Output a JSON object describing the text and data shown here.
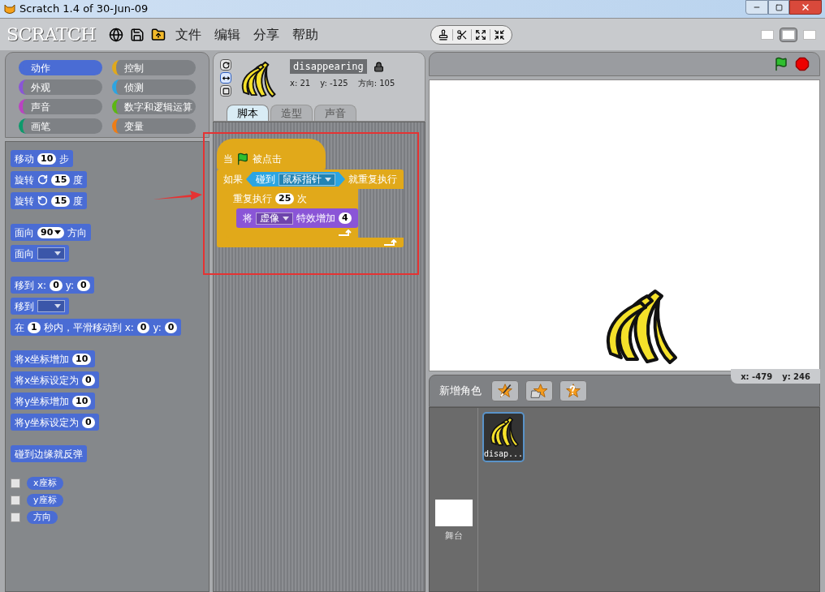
{
  "window": {
    "title": "Scratch 1.4 of 30-Jun-09"
  },
  "menu": {
    "logo": "SCRATCH",
    "items": [
      "文件",
      "编辑",
      "分享",
      "帮助"
    ]
  },
  "view_modes": [
    {
      "selected": false
    },
    {
      "selected": true
    },
    {
      "selected": false
    }
  ],
  "categories": [
    {
      "label": "动作",
      "color": "#4a6cd4",
      "selected": true
    },
    {
      "label": "控制",
      "color": "#e1a91a",
      "selected": false
    },
    {
      "label": "外观",
      "color": "#8a55d7",
      "selected": false
    },
    {
      "label": "侦测",
      "color": "#2ca5e2",
      "selected": false
    },
    {
      "label": "声音",
      "color": "#bb42c3",
      "selected": false
    },
    {
      "label": "数字和逻辑运算",
      "color": "#5cb712",
      "selected": false
    },
    {
      "label": "画笔",
      "color": "#0e9a6c",
      "selected": false
    },
    {
      "label": "变量",
      "color": "#ee7d16",
      "selected": false
    }
  ],
  "palette": {
    "groups": [
      [
        {
          "kind": "command",
          "parts": [
            {
              "kind": "text",
              "text": "移动"
            },
            {
              "kind": "number",
              "text": "10"
            },
            {
              "kind": "text",
              "text": "步"
            }
          ]
        },
        {
          "kind": "command",
          "parts": [
            {
              "kind": "text",
              "text": "旋转"
            },
            {
              "kind": "rotate_cw"
            },
            {
              "kind": "number",
              "text": "15"
            },
            {
              "kind": "text",
              "text": "度"
            }
          ]
        },
        {
          "kind": "command",
          "parts": [
            {
              "kind": "text",
              "text": "旋转"
            },
            {
              "kind": "rotate_ccw"
            },
            {
              "kind": "number",
              "text": "15"
            },
            {
              "kind": "text",
              "text": "度"
            }
          ]
        }
      ],
      [
        {
          "kind": "command",
          "parts": [
            {
              "kind": "text",
              "text": "面向"
            },
            {
              "kind": "number_dropdown",
              "text": "90"
            },
            {
              "kind": "text",
              "text": "方向"
            }
          ]
        },
        {
          "kind": "command",
          "parts": [
            {
              "kind": "text",
              "text": "面向"
            },
            {
              "kind": "dropdown"
            }
          ]
        }
      ],
      [
        {
          "kind": "command",
          "parts": [
            {
              "kind": "text",
              "text": "移到"
            },
            {
              "kind": "text",
              "text": "x:"
            },
            {
              "kind": "number",
              "text": "0"
            },
            {
              "kind": "text",
              "text": "y:"
            },
            {
              "kind": "number",
              "text": "0"
            }
          ]
        },
        {
          "kind": "command",
          "parts": [
            {
              "kind": "text",
              "text": "移到"
            },
            {
              "kind": "dropdown"
            }
          ]
        },
        {
          "kind": "command",
          "parts": [
            {
              "kind": "text",
              "text": "在"
            },
            {
              "kind": "number",
              "text": "1"
            },
            {
              "kind": "text",
              "text": "秒内，平滑移动到"
            },
            {
              "kind": "text",
              "text": "x:"
            },
            {
              "kind": "number",
              "text": "0"
            },
            {
              "kind": "text",
              "text": "y:"
            },
            {
              "kind": "number",
              "text": "0"
            }
          ]
        }
      ],
      [
        {
          "kind": "command",
          "parts": [
            {
              "kind": "text",
              "text": "将x坐标增加"
            },
            {
              "kind": "number",
              "text": "10"
            }
          ]
        },
        {
          "kind": "command",
          "parts": [
            {
              "kind": "text",
              "text": "将x坐标设定为"
            },
            {
              "kind": "number",
              "text": "0"
            }
          ]
        },
        {
          "kind": "command",
          "parts": [
            {
              "kind": "text",
              "text": "将y坐标增加"
            },
            {
              "kind": "number",
              "text": "10"
            }
          ]
        },
        {
          "kind": "command",
          "parts": [
            {
              "kind": "text",
              "text": "将y坐标设定为"
            },
            {
              "kind": "number",
              "text": "0"
            }
          ]
        }
      ],
      [
        {
          "kind": "command",
          "parts": [
            {
              "kind": "text",
              "text": "碰到边缘就反弹"
            }
          ]
        }
      ],
      [
        {
          "kind": "reporter",
          "checked": false,
          "parts": [
            {
              "kind": "text",
              "text": "x座标"
            }
          ]
        },
        {
          "kind": "reporter",
          "checked": false,
          "parts": [
            {
              "kind": "text",
              "text": "y座标"
            }
          ]
        },
        {
          "kind": "reporter",
          "checked": false,
          "parts": [
            {
              "kind": "text",
              "text": "方向"
            }
          ]
        }
      ]
    ]
  },
  "sprite": {
    "name": "disappearing",
    "x": "x: 21",
    "y": "y: -125",
    "direction": "方向: 105",
    "rotation_styles": [
      {
        "kind": "rotate",
        "selected": false
      },
      {
        "kind": "flip",
        "selected": true
      },
      {
        "kind": "none",
        "selected": false
      }
    ]
  },
  "tabs": [
    {
      "label": "脚本",
      "selected": true
    },
    {
      "label": "造型",
      "selected": false
    },
    {
      "label": "声音",
      "selected": false
    }
  ],
  "script": [
    {
      "kind": "hat",
      "color": "#e1a91a",
      "parts": [
        {
          "kind": "text",
          "text": "当"
        },
        {
          "kind": "flag"
        },
        {
          "kind": "text",
          "text": "被点击"
        }
      ]
    },
    {
      "kind": "c_block",
      "color": "#e1a91a",
      "parts": [
        {
          "kind": "text",
          "text": "如果"
        },
        {
          "kind": "boolean",
          "color": "#2ca5e2",
          "parts": [
            {
              "kind": "text",
              "text": "碰到"
            },
            {
              "kind": "dropdown",
              "text": "鼠标指针"
            }
          ]
        },
        {
          "kind": "text",
          "text": "就重复执行"
        }
      ],
      "children": [
        {
          "kind": "c_block",
          "color": "#e1a91a",
          "parts": [
            {
              "kind": "text",
              "text": "重复执行"
            },
            {
              "kind": "number",
              "text": "25"
            },
            {
              "kind": "text",
              "text": "次"
            }
          ],
          "children": [
            {
              "kind": "command",
              "color": "#8a55d7",
              "parts": [
                {
                  "kind": "text",
                  "text": "将"
                },
                {
                  "kind": "dropdown",
                  "text": "虚像"
                },
                {
                  "kind": "text",
                  "text": "特效增加"
                },
                {
                  "kind": "number",
                  "text": "4"
                }
              ]
            }
          ]
        }
      ]
    }
  ],
  "sprite_pane": {
    "title": "新增角色",
    "mouse_x": "x: -479",
    "mouse_y": "y: 246",
    "stage_label": "舞台",
    "sprites": [
      {
        "name": "disap...",
        "selected": true
      }
    ]
  }
}
